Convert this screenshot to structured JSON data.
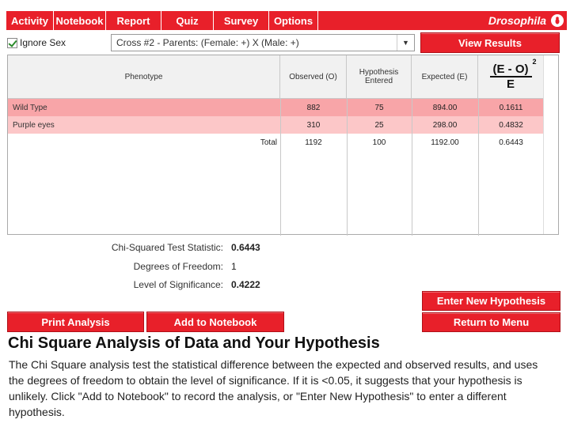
{
  "nav": {
    "tabs": [
      "Activity",
      "Notebook",
      "Report",
      "Quiz",
      "Survey",
      "Options"
    ],
    "brand": "Drosophila",
    "brand_color": "#e8202a"
  },
  "controls": {
    "ignore_sex_label": "Ignore Sex",
    "ignore_sex_checked": true,
    "cross_value": "Cross #2 - Parents: (Female: +) X (Male: +)",
    "view_results": "View Results"
  },
  "table": {
    "headers": {
      "phenotype": "Phenotype",
      "observed": "Observed (O)",
      "hypothesis": "Hypothesis Entered",
      "expected": "Expected (E)",
      "formula_num": "(E - O)",
      "formula_exp": "2",
      "formula_den": "E"
    },
    "rows": [
      {
        "phenotype": "Wild Type",
        "observed": "882",
        "hypothesis": "75",
        "expected": "894.00",
        "chi": "0.1611"
      },
      {
        "phenotype": "Purple eyes",
        "observed": "310",
        "hypothesis": "25",
        "expected": "298.00",
        "chi": "0.4832"
      }
    ],
    "total": {
      "label": "Total",
      "observed": "1192",
      "hypothesis": "100",
      "expected": "1192.00",
      "chi": "0.6443"
    }
  },
  "stats": {
    "chi_label": "Chi-Squared Test Statistic:",
    "chi_value": "0.6443",
    "dof_label": "Degrees of Freedom:",
    "dof_value": "1",
    "sig_label": "Level of Significance:",
    "sig_value": "0.4222"
  },
  "buttons": {
    "enter_hypothesis": "Enter New Hypothesis",
    "print_analysis": "Print Analysis",
    "add_notebook": "Add to Notebook",
    "return_menu": "Return to Menu"
  },
  "text": {
    "heading": "Chi Square Analysis of Data and Your Hypothesis",
    "paragraph": "The Chi Square analysis test the statistical difference between the expected and observed results, and uses the degrees of freedom to obtain the level of significance. If it is <0.05, it suggests that your hypothesis is unlikely. Click \"Add to Notebook\" to record the analysis, or \"Enter New Hypothesis\" to enter a different hypothesis."
  }
}
